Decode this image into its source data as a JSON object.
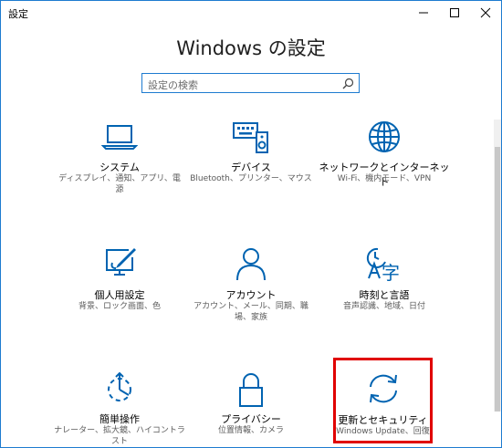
{
  "window": {
    "title": "設定"
  },
  "main": {
    "heading": "Windows の設定",
    "search": {
      "placeholder": "設定の検索"
    }
  },
  "tiles": [
    {
      "label": "システム",
      "desc_lines": [
        "ディスプレイ、通知、アプリ、電",
        "源"
      ],
      "icon": "laptop-icon"
    },
    {
      "label": "デバイス",
      "desc_lines": [
        "Bluetooth、プリンター、マウス"
      ],
      "icon": "keyboard-speaker-icon"
    },
    {
      "label": "ネットワークとインターネット",
      "desc_lines": [
        "Wi-Fi、機内モード、VPN"
      ],
      "icon": "globe-icon"
    },
    {
      "label": "個人用設定",
      "desc_lines": [
        "背景、ロック画面、色"
      ],
      "icon": "paint-monitor-icon"
    },
    {
      "label": "アカウント",
      "desc_lines": [
        "アカウント、メール、同期、職",
        "場、家族"
      ],
      "icon": "person-icon"
    },
    {
      "label": "時刻と言語",
      "desc_lines": [
        "音声認識、地域、日付"
      ],
      "icon": "time-language-icon"
    },
    {
      "label": "簡単操作",
      "desc_lines": [
        "ナレーター、拡大鏡、ハイコントラ",
        "スト"
      ],
      "icon": "ease-of-access-icon"
    },
    {
      "label": "プライバシー",
      "desc_lines": [
        "位置情報、カメラ"
      ],
      "icon": "lock-icon"
    },
    {
      "label": "更新とセキュリティ",
      "desc_lines": [
        "Windows Update、回復"
      ],
      "icon": "sync-arrows-icon",
      "highlighted": true
    }
  ],
  "colors": {
    "accent": "#0063b1",
    "highlight_border": "#e00000",
    "window_border": "#1e7bd0"
  }
}
